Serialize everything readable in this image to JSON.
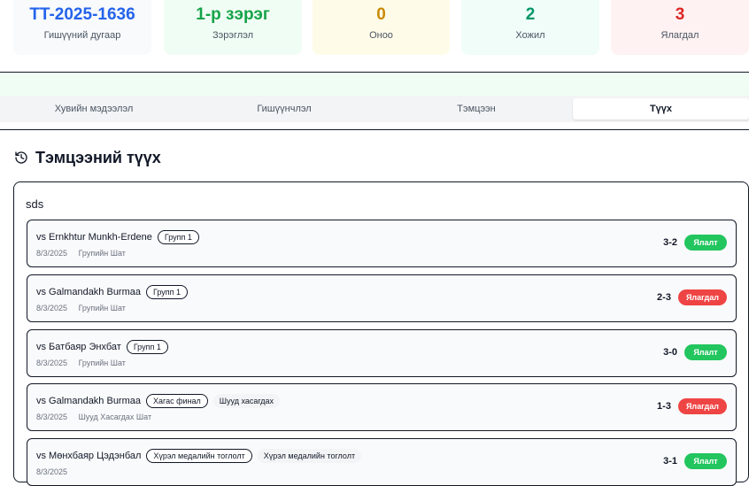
{
  "stats": [
    {
      "value": "TT-2025-1636",
      "label": "Гишүүний дугаар"
    },
    {
      "value": "1-р зэрэг",
      "label": "Зэрэглэл"
    },
    {
      "value": "0",
      "label": "Оноо"
    },
    {
      "value": "2",
      "label": "Хожил"
    },
    {
      "value": "3",
      "label": "Ялагдал"
    }
  ],
  "tabs": [
    "Хувийн мэдээлэл",
    "Гишүүнчлэл",
    "Тэмцээн",
    "Түүх"
  ],
  "active_tab": "Түүх",
  "section_title": "Тэмцээний түүх",
  "tournament": {
    "name": "sds",
    "matches": [
      {
        "opponent": "vs Ernkhtur Munkh-Erdene",
        "badge": "Групп 1",
        "badge2": "",
        "date": "8/3/2025",
        "stage": "Групийн Шат",
        "score": "3-2",
        "result": "Ялалт",
        "outcome": "win"
      },
      {
        "opponent": "vs Galmandakh Burmaa",
        "badge": "Групп 1",
        "badge2": "",
        "date": "8/3/2025",
        "stage": "Групийн Шат",
        "score": "2-3",
        "result": "Ялагдал",
        "outcome": "loss"
      },
      {
        "opponent": "vs Батбаяр Энхбат",
        "badge": "Групп 1",
        "badge2": "",
        "date": "8/3/2025",
        "stage": "Групийн Шат",
        "score": "3-0",
        "result": "Ялалт",
        "outcome": "win"
      },
      {
        "opponent": "vs Galmandakh Burmaa",
        "badge": "Хагас финал",
        "badge2": "Шууд хасагдах",
        "date": "8/3/2025",
        "stage": "Шууд Хасагдах Шат",
        "score": "1-3",
        "result": "Ялагдал",
        "outcome": "loss"
      },
      {
        "opponent": "vs Мөнхбаяр Цэдэнбал",
        "badge": "Хүрэл медалийн тоглолт",
        "badge2": "Хүрэл медалийн тоглолт",
        "date": "8/3/2025",
        "stage": "",
        "score": "3-1",
        "result": "Ялалт",
        "outcome": "win"
      }
    ]
  },
  "colors": {
    "win": "#22c55e",
    "loss": "#ef4444",
    "accent": "#2563eb"
  }
}
